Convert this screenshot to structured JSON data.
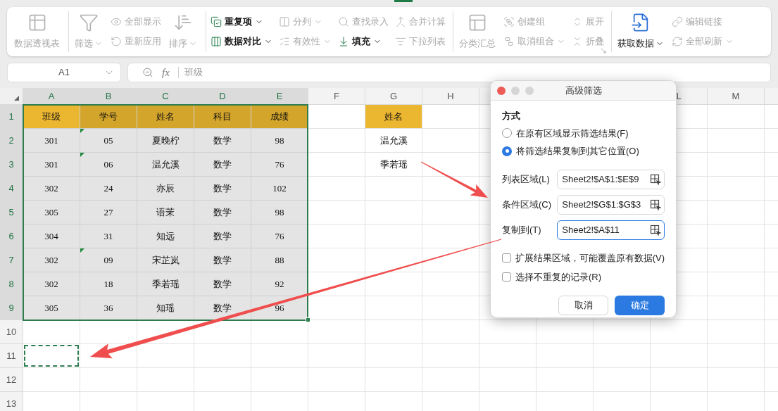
{
  "ribbon": {
    "groups": [
      {
        "items": [
          {
            "kind": "large",
            "label": "数据透视表",
            "disabled": true,
            "caret": false
          }
        ]
      },
      {
        "items": [
          {
            "kind": "large",
            "label": "筛选",
            "disabled": true,
            "caret": true
          },
          {
            "kind": "stack",
            "items": [
              {
                "label": "全部显示",
                "disabled": true,
                "caret": false
              },
              {
                "label": "重新应用",
                "disabled": true,
                "caret": false
              }
            ]
          },
          {
            "kind": "large",
            "label": "排序",
            "disabled": true,
            "caret": true
          }
        ]
      },
      {
        "items": [
          {
            "kind": "stack",
            "items": [
              {
                "label": "重复项",
                "disabled": false,
                "caret": true
              },
              {
                "label": "数据对比",
                "disabled": false,
                "caret": true
              }
            ]
          },
          {
            "kind": "stack",
            "items": [
              {
                "label": "分列",
                "disabled": true,
                "caret": true
              },
              {
                "label": "有效性",
                "disabled": true,
                "caret": true
              }
            ]
          },
          {
            "kind": "stack",
            "items": [
              {
                "label": "查找录入",
                "disabled": true,
                "caret": false
              },
              {
                "label": "填充",
                "disabled": false,
                "caret": true
              }
            ]
          },
          {
            "kind": "stack",
            "items": [
              {
                "label": "合并计算",
                "disabled": true,
                "caret": false
              },
              {
                "label": "下拉列表",
                "disabled": true,
                "caret": false
              }
            ]
          }
        ]
      },
      {
        "launcher": true,
        "items": [
          {
            "kind": "large",
            "label": "分类汇总",
            "disabled": true,
            "caret": false
          },
          {
            "kind": "stack",
            "items": [
              {
                "label": "创建组",
                "disabled": true,
                "caret": false
              },
              {
                "label": "取消组合",
                "disabled": true,
                "caret": true
              }
            ]
          },
          {
            "kind": "stack",
            "items": [
              {
                "label": "展开",
                "disabled": true,
                "caret": false
              },
              {
                "label": "折叠",
                "disabled": true,
                "caret": false
              }
            ]
          }
        ]
      },
      {
        "items": [
          {
            "kind": "large",
            "label": "获取数据",
            "disabled": false,
            "caret": true
          },
          {
            "kind": "stack",
            "items": [
              {
                "label": "编辑链接",
                "disabled": true,
                "caret": false
              },
              {
                "label": "全部刷新",
                "disabled": true,
                "caret": true
              }
            ]
          }
        ]
      }
    ]
  },
  "formula_bar": {
    "cell_ref": "A1",
    "function_label": "fx",
    "content": "班级"
  },
  "sheet": {
    "columns": [
      {
        "label": "A",
        "selected": true
      },
      {
        "label": "B",
        "selected": true
      },
      {
        "label": "C",
        "selected": true
      },
      {
        "label": "D",
        "selected": true
      },
      {
        "label": "E",
        "selected": true
      },
      {
        "label": "F",
        "selected": false
      },
      {
        "label": "G",
        "selected": false
      },
      {
        "label": "H",
        "selected": false
      },
      {
        "selected": false
      },
      {},
      {},
      {
        "label": "L",
        "selected": false
      },
      {
        "label": "M",
        "selected": false
      },
      {
        "selected": false
      }
    ],
    "rows": [
      {
        "number": "1",
        "selected": true,
        "cells": [
          {
            "text": "班级",
            "kind": "header",
            "active": true
          },
          {
            "text": "学号",
            "kind": "header"
          },
          {
            "text": "姓名",
            "kind": "header"
          },
          {
            "text": "科目",
            "kind": "header"
          },
          {
            "text": "成绩",
            "kind": "header"
          },
          null,
          {
            "text": "姓名",
            "kind": "header"
          }
        ]
      },
      {
        "number": "2",
        "selected": true,
        "cells": [
          {
            "text": "301"
          },
          {
            "text": "05",
            "flag": true
          },
          {
            "text": "夏晚柠"
          },
          {
            "text": "数学"
          },
          {
            "text": "98"
          },
          null,
          {
            "text": "温允溪"
          }
        ]
      },
      {
        "number": "3",
        "selected": true,
        "cells": [
          {
            "text": "301"
          },
          {
            "text": "06",
            "flag": true
          },
          {
            "text": "温允溪"
          },
          {
            "text": "数学"
          },
          {
            "text": "76"
          },
          null,
          {
            "text": "季若瑶"
          }
        ]
      },
      {
        "number": "4",
        "selected": true,
        "cells": [
          {
            "text": "302"
          },
          {
            "text": "24"
          },
          {
            "text": "亦辰"
          },
          {
            "text": "数学"
          },
          {
            "text": "102"
          }
        ]
      },
      {
        "number": "5",
        "selected": true,
        "cells": [
          {
            "text": "305"
          },
          {
            "text": "27"
          },
          {
            "text": "语茉"
          },
          {
            "text": "数学"
          },
          {
            "text": "98"
          }
        ]
      },
      {
        "number": "6",
        "selected": true,
        "cells": [
          {
            "text": "304"
          },
          {
            "text": "31"
          },
          {
            "text": "知远"
          },
          {
            "text": "数学"
          },
          {
            "text": "76"
          }
        ]
      },
      {
        "number": "7",
        "selected": true,
        "cells": [
          {
            "text": "302"
          },
          {
            "text": "09",
            "flag": true
          },
          {
            "text": "宋芷岚"
          },
          {
            "text": "数学"
          },
          {
            "text": "88"
          }
        ]
      },
      {
        "number": "8",
        "selected": true,
        "cells": [
          {
            "text": "302"
          },
          {
            "text": "18"
          },
          {
            "text": "季若瑶"
          },
          {
            "text": "数学"
          },
          {
            "text": "92"
          }
        ]
      },
      {
        "number": "9",
        "selected": true,
        "cells": [
          {
            "text": "305"
          },
          {
            "text": "36"
          },
          {
            "text": "知瑶"
          },
          {
            "text": "数学"
          },
          {
            "text": "96"
          }
        ]
      },
      {
        "number": "10",
        "selected": false,
        "cells": []
      },
      {
        "number": "11",
        "selected": false,
        "cells": [
          {
            "marquee": true
          }
        ]
      },
      {
        "number": "12",
        "selected": false,
        "cells": []
      },
      {
        "number": "13",
        "selected": false,
        "cells": []
      }
    ]
  },
  "dialog": {
    "title": "高级筛选",
    "section_label": "方式",
    "options": [
      {
        "label": "在原有区域显示筛选结果(F)",
        "selected": false
      },
      {
        "label": "将筛选结果复制到其它位置(O)",
        "selected": true
      }
    ],
    "fields": [
      {
        "label": "列表区域(L)",
        "value": "Sheet2!$A$1:$E$9",
        "focused": false
      },
      {
        "label": "条件区域(C)",
        "value": "Sheet2!$G$1:$G$3",
        "focused": false
      },
      {
        "label": "复制到(T)",
        "value": "Sheet2!$A$11",
        "focused": true
      }
    ],
    "checks": [
      {
        "label": "扩展结果区域，可能覆盖原有数据(V)",
        "checked": false
      },
      {
        "label": "选择不重复的记录(R)",
        "checked": false
      }
    ],
    "buttons": [
      {
        "label": "取消",
        "kind": "secondary"
      },
      {
        "label": "确定",
        "kind": "primary"
      }
    ]
  }
}
